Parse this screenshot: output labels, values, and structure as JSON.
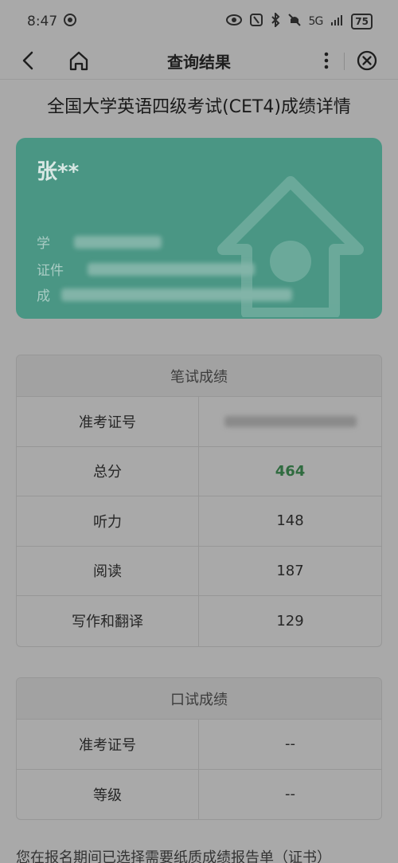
{
  "status_bar": {
    "time": "8:47",
    "signal": "5G",
    "battery": "75"
  },
  "nav": {
    "title": "查询结果"
  },
  "page": {
    "heading": "全国大学英语四级考试(CET4)成绩详情"
  },
  "card": {
    "name": "张**",
    "rows": [
      {
        "label": "学"
      },
      {
        "label": "证件"
      },
      {
        "label": "成"
      }
    ]
  },
  "written": {
    "header": "笔试成绩",
    "rows": [
      {
        "label": "准考证号",
        "value": ""
      },
      {
        "label": "总分",
        "value": "464"
      },
      {
        "label": "听力",
        "value": "148"
      },
      {
        "label": "阅读",
        "value": "187"
      },
      {
        "label": "写作和翻译",
        "value": "129"
      }
    ]
  },
  "oral": {
    "header": "口试成绩",
    "rows": [
      {
        "label": "准考证号",
        "value": "--"
      },
      {
        "label": "等级",
        "value": "--"
      }
    ]
  },
  "footer": {
    "text": "您在报名期间已选择需要纸质成绩报告单（证书）"
  }
}
